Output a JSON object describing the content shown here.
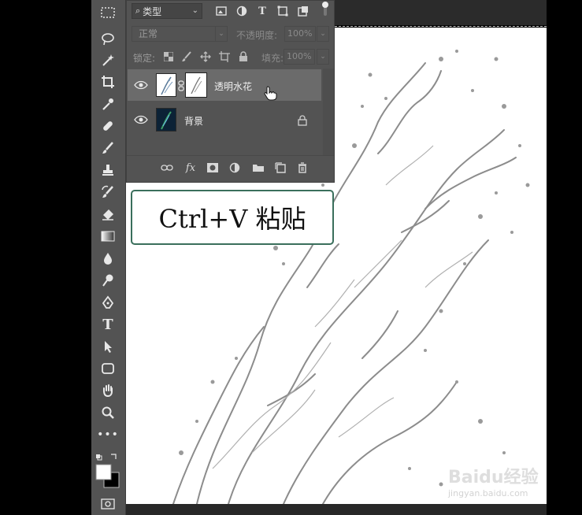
{
  "layers_panel": {
    "filter_label": "类型",
    "blend_mode": "正常",
    "opacity_label": "不透明度:",
    "opacity_value": "100%",
    "lock_label": "锁定:",
    "fill_label": "填充:",
    "fill_value": "100%",
    "layers": [
      {
        "name": "透明水花",
        "selected": true
      },
      {
        "name": "背景",
        "selected": false,
        "locked": true
      }
    ]
  },
  "callout": {
    "text": "Ctrl+V 粘贴"
  },
  "watermark": {
    "brand": "Baidu经验",
    "url": "jingyan.baidu.com"
  },
  "tools": [
    "marquee-icon",
    "lasso-icon",
    "magic-wand-icon",
    "crop-icon",
    "eyedropper-icon",
    "healing-brush-icon",
    "brush-icon",
    "clone-stamp-icon",
    "history-brush-icon",
    "eraser-icon",
    "gradient-icon",
    "blur-icon",
    "dodge-icon",
    "pen-icon",
    "type-icon",
    "path-selection-icon",
    "rectangle-icon",
    "hand-icon",
    "zoom-icon",
    "more-tools-icon"
  ],
  "colors": {
    "toolbar_bg": "#535353",
    "panel_bg": "#535353",
    "selected_layer_bg": "#6b6b6b",
    "callout_border": "#3a6f5c"
  }
}
